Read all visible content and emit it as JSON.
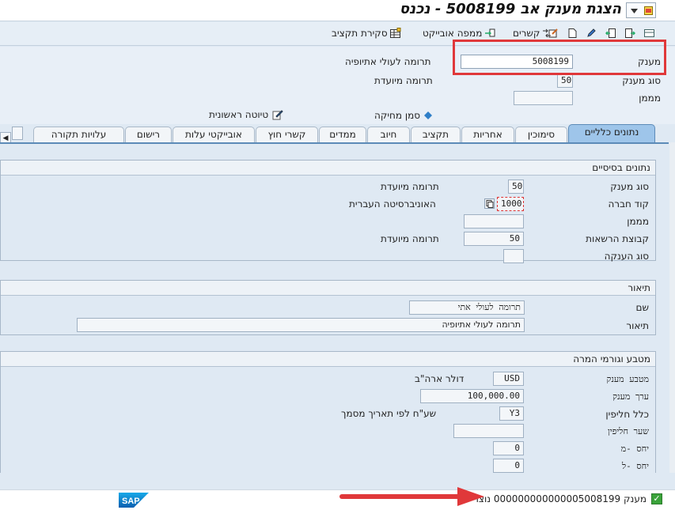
{
  "window": {
    "title": "הצגת מענק אב 5008199 - נכנס"
  },
  "toolbar": {
    "budget_sheet_label": "סקירת תקציב",
    "object_mapping_label": "ממפה אובייקט",
    "relationships_label": "קשרים"
  },
  "header": {
    "grant_label": "מענק",
    "grant_value": "5008199",
    "grant_desc": "תרומה לעולי אתיופיה",
    "grant_type_label": "סוג מענק",
    "grant_type_value": "50",
    "grant_type_desc": "תרומה מיועדת",
    "sponsor_label": "מממן",
    "sponsor_value": "",
    "deletion_flag_label": "סמן מחיקה",
    "first_draft_label": "טיוטה ראשונית"
  },
  "tabs": [
    {
      "label": "נתונים כלליים",
      "active": true
    },
    {
      "label": "סימוכין"
    },
    {
      "label": "אחריות"
    },
    {
      "label": "תקציב"
    },
    {
      "label": "חיוב"
    },
    {
      "label": "ממדים"
    },
    {
      "label": "קשרי חוץ"
    },
    {
      "label": "אובייקטי עלות"
    },
    {
      "label": "רישום"
    },
    {
      "label": "עלויות תקורה"
    }
  ],
  "basic": {
    "title": "נתונים בסיסיים",
    "grant_type_label": "סוג מענק",
    "grant_type_value": "50",
    "grant_type_desc": "תרומה מיועדת",
    "company_code_label": "קוד חברה",
    "company_code_value": "1000",
    "company_code_desc": "האוניברסיטה העברית",
    "sponsor_label": "מממן",
    "sponsor_value": "",
    "auth_group_label": "קבוצת הרשאות",
    "auth_group_value": "50",
    "auth_group_desc": "תרומה מיועדת",
    "award_type_label": "סוג הענקה",
    "award_type_value": ""
  },
  "description": {
    "title": "תיאור",
    "name_label": "שם",
    "name_value": "תרומה לעולי אתי",
    "desc_label": "תיאור",
    "desc_value": "תרומה לעולי אתיופיה"
  },
  "currency": {
    "title": "מטבע וגורמי המרה",
    "grant_currency_label": "מטבע מענק",
    "grant_currency_value": "USD",
    "grant_currency_desc": "דולר ארה\"ב",
    "grant_value_label": "ערך מענק",
    "grant_value_value": "100,000.00",
    "exchange_rule_label": "כלל חליפין",
    "exchange_rule_value": "Y3",
    "exchange_rule_desc": "שע\"ח לפי תאריך מסמך",
    "exchange_rate_label": "שער חליפין",
    "exchange_rate_value": "",
    "ratio_from_label": "יחס -מ",
    "ratio_from_value": "0",
    "ratio_to_label": "יחס -ל",
    "ratio_to_value": "0"
  },
  "status": {
    "message": "מענק 000000000000005008199 נוצר",
    "brand": "SAP"
  },
  "colors": {
    "highlight_red": "#e0383a",
    "active_tab": "#9ec5ea",
    "status_ok": "#3aa33a"
  }
}
